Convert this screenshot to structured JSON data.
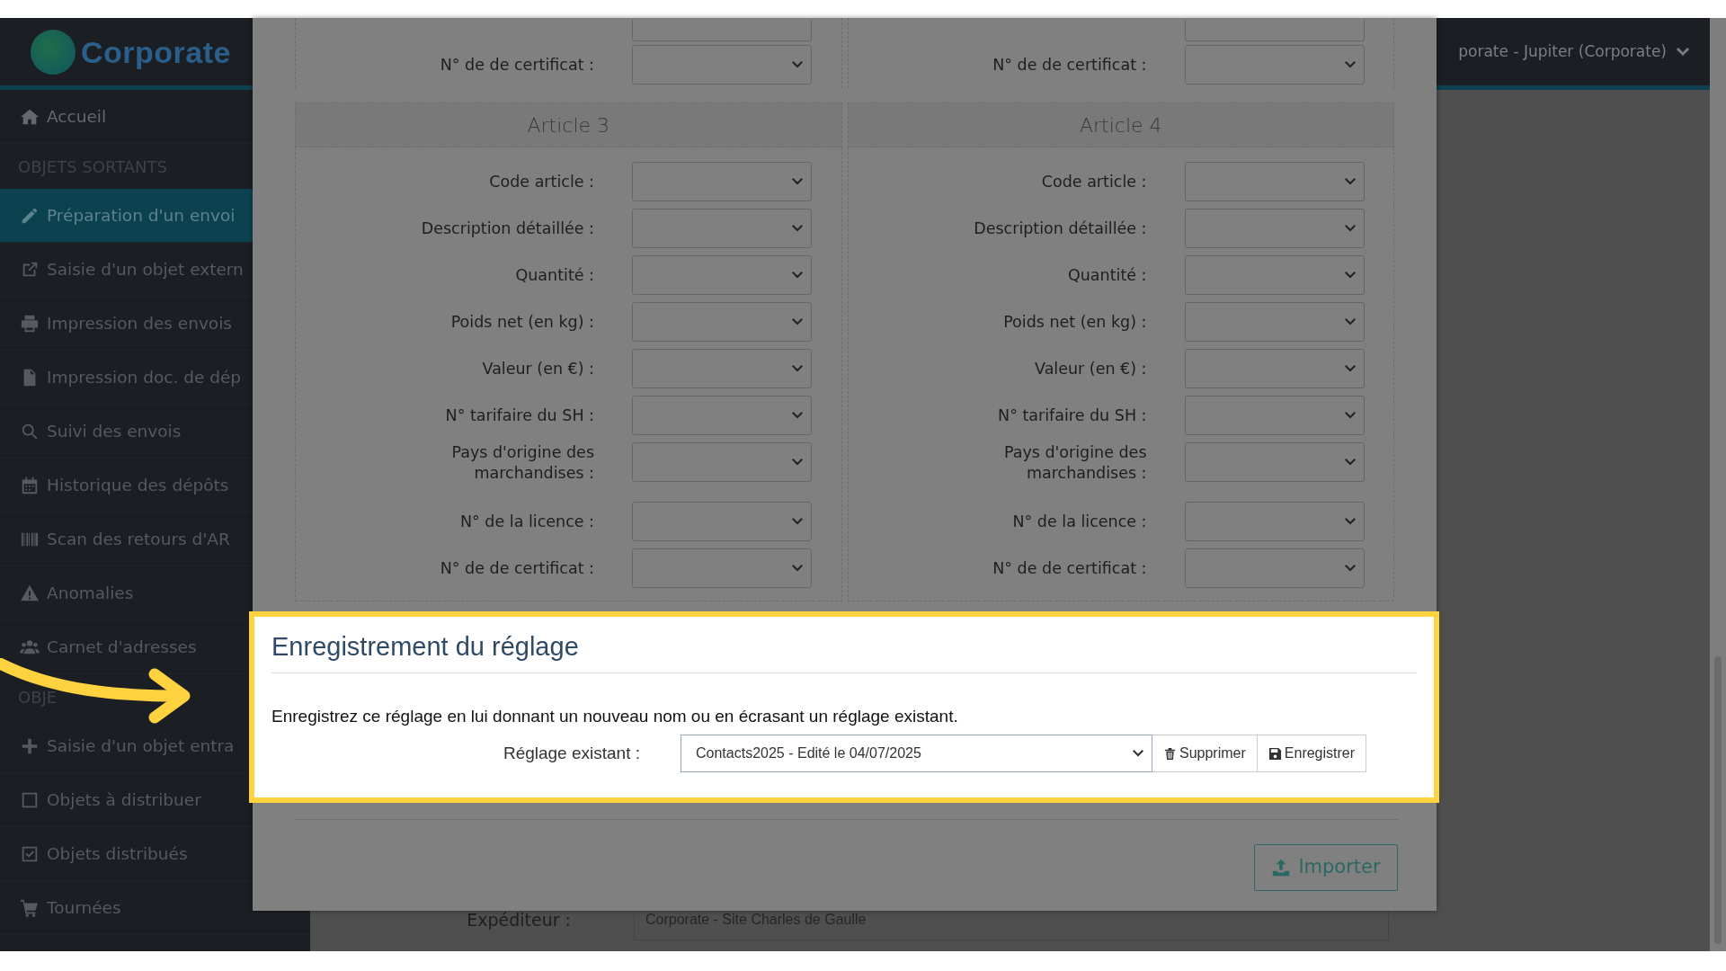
{
  "sidebar": {
    "logo": "Corporate",
    "items": [
      {
        "kind": "link",
        "label": "Accueil",
        "selected": false
      },
      {
        "kind": "header",
        "label": "OBJETS SORTANTS"
      },
      {
        "kind": "link",
        "label": "Préparation d'un envoi",
        "selected": true
      },
      {
        "kind": "link",
        "label": "Saisie d'un objet extern",
        "selected": false
      },
      {
        "kind": "link",
        "label": "Impression des envois",
        "selected": false
      },
      {
        "kind": "link",
        "label": "Impression doc. de dép",
        "selected": false
      },
      {
        "kind": "link",
        "label": "Suivi des envois",
        "selected": false
      },
      {
        "kind": "link",
        "label": "Historique des dépôts",
        "selected": false
      },
      {
        "kind": "link",
        "label": "Scan des retours d'AR",
        "selected": false
      },
      {
        "kind": "link",
        "label": "Anomalies",
        "selected": false
      },
      {
        "kind": "link",
        "label": "Carnet d'adresses",
        "selected": false
      },
      {
        "kind": "header",
        "label": "OBJE"
      },
      {
        "kind": "link",
        "label": "Saisie d'un objet entra",
        "selected": false
      },
      {
        "kind": "link",
        "label": "Objets à distribuer",
        "selected": false
      },
      {
        "kind": "link",
        "label": "Objets distribués",
        "selected": false
      },
      {
        "kind": "link",
        "label": "Tournées",
        "selected": false
      }
    ]
  },
  "topbar": {
    "account": "porate - Jupiter (Corporate)"
  },
  "modal": {
    "previous_articles": [
      {
        "last_field": "N° de de certificat :"
      },
      {
        "last_field": "N° de de certificat :"
      }
    ],
    "articles": [
      {
        "title": "Article 3",
        "fields": [
          "Code article :",
          "Description détaillée :",
          "Quantité :",
          "Poids net (en kg) :",
          "Valeur (en €) :",
          "N° tarifaire du SH :",
          "Pays d'origine des marchandises :",
          "N° de la licence :",
          "N° de de certificat :"
        ]
      },
      {
        "title": "Article 4",
        "fields": [
          "Code article :",
          "Description détaillée :",
          "Quantité :",
          "Poids net (en kg) :",
          "Valeur (en €) :",
          "N° tarifaire du SH :",
          "Pays d'origine des marchandises :",
          "N° de la licence :",
          "N° de de certificat :"
        ]
      }
    ],
    "save_setting": {
      "title": "Enregistrement du réglage",
      "text": "Enregistrez ce réglage en lui donnant un nouveau nom ou en écrasant un réglage existant.",
      "label": "Réglage existant :",
      "value": "Contacts2025 - Edité le 04/07/2025",
      "buttons": [
        {
          "kind": "delete",
          "label": "Supprimer"
        },
        {
          "kind": "save",
          "label": "Enregistrer"
        }
      ]
    },
    "import_button": "Importer"
  },
  "background_form": {
    "label": "Expéditeur :",
    "value": "Corporate - Site Charles de Gaulle"
  }
}
